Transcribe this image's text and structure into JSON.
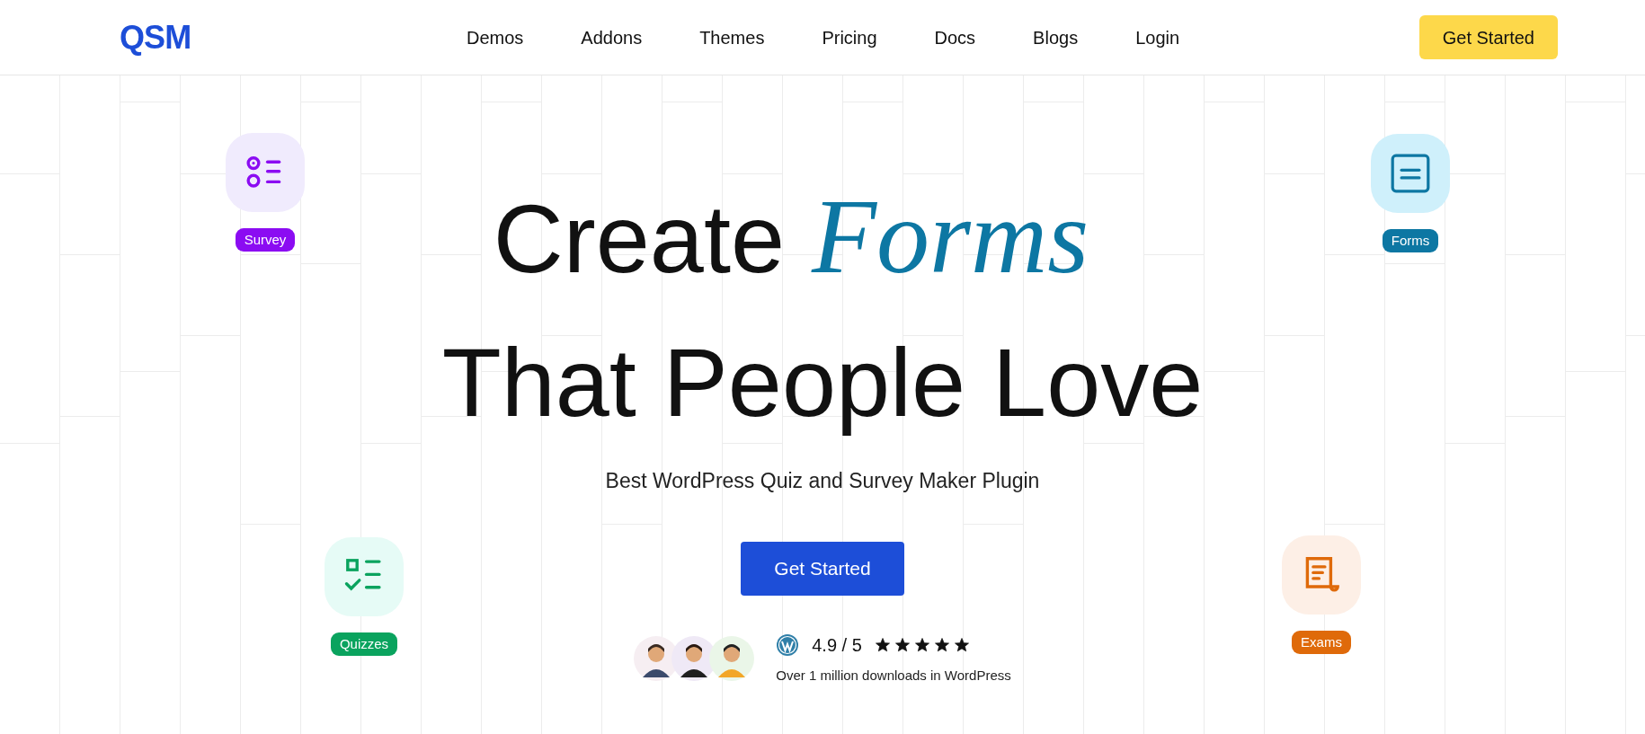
{
  "logo": "QSM",
  "nav": [
    "Demos",
    "Addons",
    "Themes",
    "Pricing",
    "Docs",
    "Blogs",
    "Login"
  ],
  "header_button": "Get Started",
  "hero": {
    "title_line1": "Create",
    "title_accent": "Forms",
    "title_line2": "That People Love",
    "subtitle": "Best WordPress Quiz and Survey Maker Plugin",
    "button": "Get Started"
  },
  "badges": [
    {
      "kind": "survey",
      "label": "Survey",
      "color": "#8b0cf2"
    },
    {
      "kind": "forms",
      "label": "Forms",
      "color": "#0d77a3"
    },
    {
      "kind": "quizzes",
      "label": "Quizzes",
      "color": "#0aa35e"
    },
    {
      "kind": "exams",
      "label": "Exams",
      "color": "#df6a0a"
    }
  ],
  "rating": {
    "score": "4.9 / 5",
    "stars": 5,
    "caption": "Over 1 million downloads in WordPress"
  }
}
